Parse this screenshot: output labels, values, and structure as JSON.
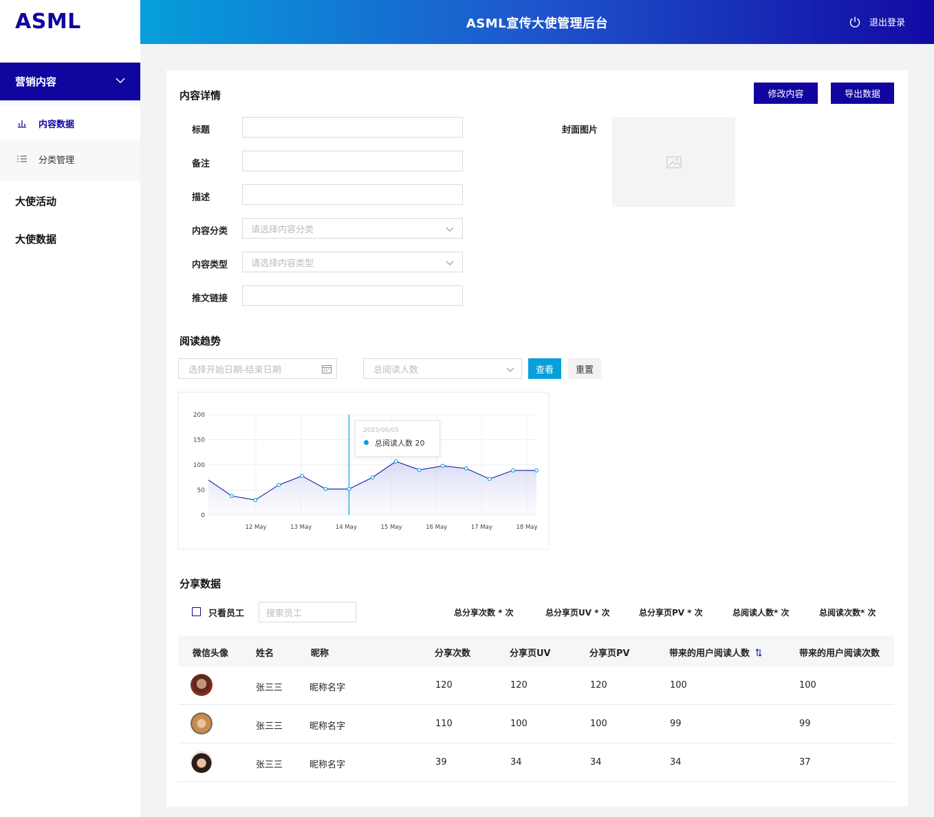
{
  "brand": {
    "logo": "ASML",
    "brand_color": "#10069f",
    "accent": "#069fdb"
  },
  "header": {
    "title": "ASML宣传大使管理后台",
    "logout_label": "退出登录",
    "logout_icon": "power-icon"
  },
  "sidebar": {
    "group_label": "营销内容",
    "sub_items": [
      {
        "label": "内容数据",
        "icon": "bar-chart-icon",
        "active": true
      },
      {
        "label": "分类管理",
        "icon": "list-icon",
        "active": false
      }
    ],
    "items": [
      {
        "label": "大使活动"
      },
      {
        "label": "大使数据"
      }
    ]
  },
  "content_detail": {
    "title": "内容详情",
    "edit_button": "修改内容",
    "export_button": "导出数据",
    "fields": [
      {
        "label": "标题",
        "value": "",
        "placeholder": ""
      },
      {
        "label": "备注",
        "value": "",
        "placeholder": ""
      },
      {
        "label": "描述",
        "value": "",
        "placeholder": ""
      },
      {
        "label": "内容分类",
        "value": "",
        "placeholder": "请选择内容分类",
        "select": true
      },
      {
        "label": "内容类型",
        "value": "",
        "placeholder": "请选择内容类型",
        "select": true
      },
      {
        "label": "推文链接",
        "value": "",
        "placeholder": ""
      }
    ],
    "cover_label": "封面图片"
  },
  "trend": {
    "title": "阅读趋势",
    "date_placeholder": "选择开始日期-结束日期",
    "metric_placeholder": "总阅读人数",
    "query_button": "查看",
    "reset_button": "重置",
    "tooltip": {
      "date": "2023/06/05",
      "label": "总阅读人数 20"
    }
  },
  "chart_data": {
    "type": "area",
    "x_ticks": [
      "12 May",
      "13 May",
      "14 May",
      "15 May",
      "16 May",
      "17 May",
      "18 May"
    ],
    "y_ticks": [
      "0",
      "50",
      "100",
      "150",
      "200"
    ],
    "ylim": [
      0,
      200
    ],
    "series": [
      {
        "values": [
          70,
          38,
          30,
          60,
          78,
          52,
          52,
          75,
          107,
          90,
          98,
          93,
          72,
          89,
          89
        ]
      }
    ],
    "line_color": "#1a1aa6",
    "point_color": "#069fdb",
    "cursor_index": 6
  },
  "share": {
    "title": "分享数据",
    "only_employee": "只看员工",
    "search_placeholder": "搜索员工",
    "stats": [
      "总分享次数 * 次",
      "总分享页UV * 次",
      "总分享页PV * 次",
      "总阅读人数* 次",
      "总阅读次数* 次"
    ],
    "columns": [
      "微信头像",
      "姓名",
      "昵称",
      "分享次数",
      "分享页UV",
      "分享页PV",
      "带来的用户阅读人数",
      "带来的用户阅读次数"
    ],
    "rows": [
      {
        "name": "张三三",
        "nickname": "昵称名字",
        "shares": "120",
        "uv": "120",
        "pv": "120",
        "readers": "100",
        "reads": "100"
      },
      {
        "name": "张三三",
        "nickname": "昵称名字",
        "shares": "110",
        "uv": "100",
        "pv": "100",
        "readers": "99",
        "reads": "99"
      },
      {
        "name": "张三三",
        "nickname": "昵称名字",
        "shares": "39",
        "uv": "34",
        "pv": "34",
        "readers": "34",
        "reads": "37"
      }
    ]
  }
}
